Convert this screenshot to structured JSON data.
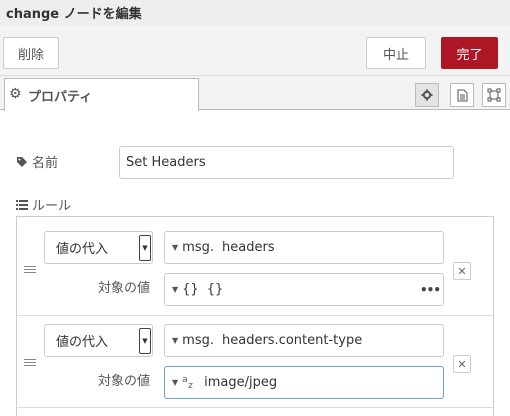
{
  "dialog": {
    "title": "change ノードを編集"
  },
  "toolbar": {
    "delete_label": "削除",
    "cancel_label": "中止",
    "done_label": "完了"
  },
  "tabs": {
    "properties_label": "プロパティ"
  },
  "form": {
    "name_label": "名前",
    "name_value": "Set Headers",
    "rules_label": "ルール"
  },
  "rules": [
    {
      "action": "値の代入",
      "target_type": "msg.",
      "target_value": "headers",
      "value_label": "対象の値",
      "value_type": "{}",
      "value_value": "{}"
    },
    {
      "action": "値の代入",
      "target_type": "msg.",
      "target_value": "headers.content-type",
      "value_label": "対象の値",
      "value_type": "az",
      "value_value": "image/jpeg"
    }
  ],
  "colors": {
    "done_button": "#ad1625",
    "focus_border": "#6ba3d6"
  },
  "icons": {
    "properties_tab": "gear-icon",
    "name_label": "tag-icon",
    "rules_label": "list-icon",
    "drag_handle": "drag-handle-icon",
    "remove": "close-icon",
    "expand": "ellipsis-icon",
    "string_type": "az-icon"
  }
}
